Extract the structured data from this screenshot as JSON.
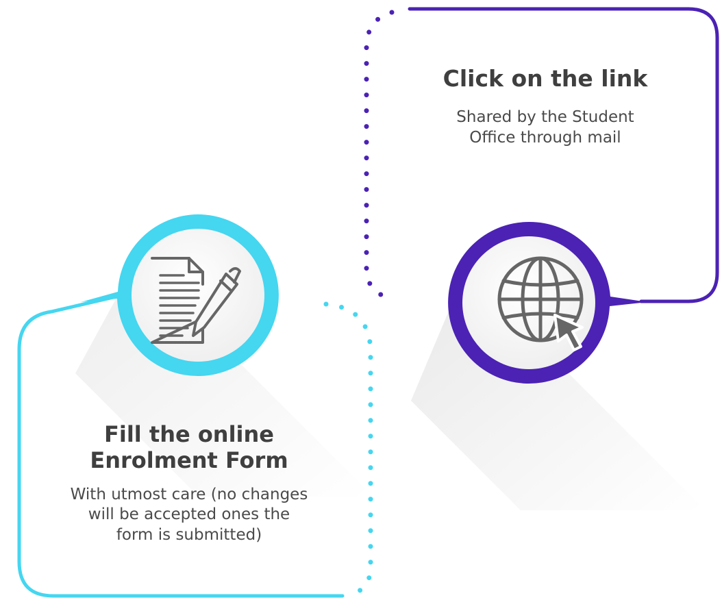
{
  "colors": {
    "step1_accent": "#4b22b4",
    "step2_accent": "#45d6f0",
    "icon_gray": "#666666",
    "circle_fill": "#f8f8f8",
    "text_dark": "#3f3f3f"
  },
  "steps": [
    {
      "title": "Click on the link",
      "description_lines": [
        "Shared by the Student",
        "Office through mail"
      ],
      "icon": "globe-cursor-icon"
    },
    {
      "title_lines": [
        "Fill the online",
        "Enrolment Form"
      ],
      "description_lines": [
        "With utmost care (no changes",
        "will be accepted ones the",
        "form is submitted)"
      ],
      "icon": "document-pen-icon"
    }
  ]
}
